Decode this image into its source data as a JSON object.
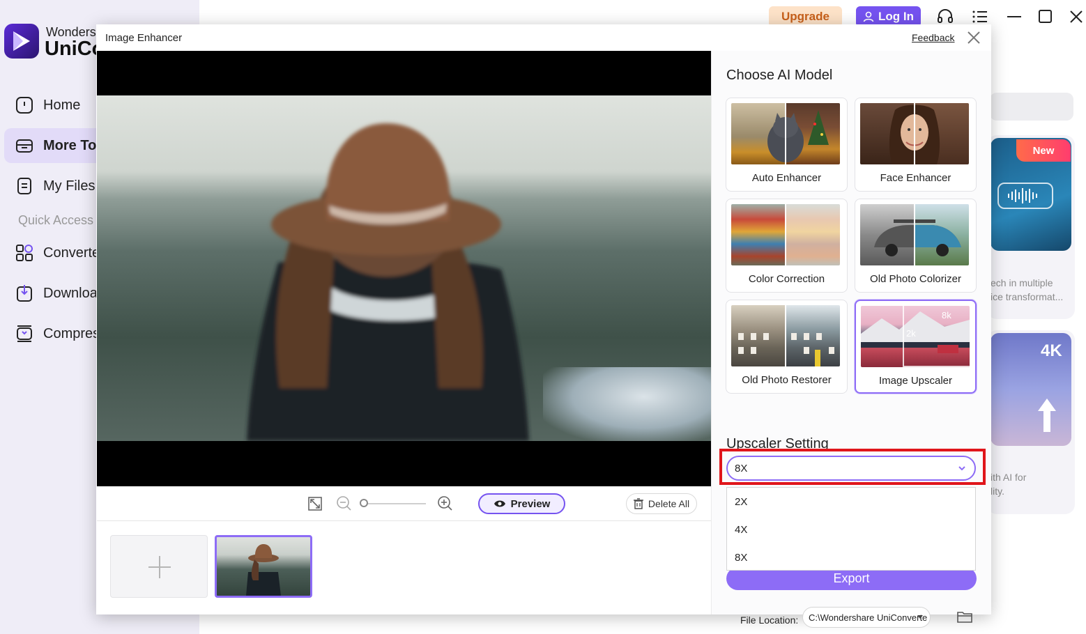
{
  "app": {
    "brand_line1": "Wonders",
    "brand_line2": "UniCo",
    "upgrade_label": "Upgrade",
    "login_label": "Log In"
  },
  "sidebar": {
    "items": [
      {
        "label": "Home",
        "icon": "home-icon"
      },
      {
        "label": "More To",
        "icon": "toolbox-icon",
        "active": true
      },
      {
        "label": "My Files",
        "icon": "files-icon"
      }
    ],
    "quick_access_label": "Quick Access",
    "quick_items": [
      {
        "label": "Converte",
        "icon": "converter-icon"
      },
      {
        "label": "Downloa",
        "icon": "download-icon"
      },
      {
        "label": "Compres",
        "icon": "compress-icon"
      }
    ]
  },
  "background_cards": {
    "new_badge": "New",
    "card1_line1": "ech in multiple",
    "card1_line2": "ice transformat...",
    "card2_badge": "4K",
    "card2_line1": "ith AI for",
    "card2_line2": "lity."
  },
  "modal": {
    "title": "Image Enhancer",
    "feedback": "Feedback",
    "preview_label": "Preview",
    "delete_all_label": "Delete All",
    "choose_model_title": "Choose AI Model",
    "models": [
      {
        "label": "Auto Enhancer"
      },
      {
        "label": "Face Enhancer"
      },
      {
        "label": "Color Correction"
      },
      {
        "label": "Old Photo Colorizer"
      },
      {
        "label": "Old Photo Restorer"
      },
      {
        "label": "Image Upscaler",
        "selected": true,
        "badges": [
          "2k",
          "8k"
        ]
      }
    ],
    "upscaler_setting_title": "Upscaler Setting",
    "upscale_value": "8X",
    "upscale_options": [
      "2X",
      "4X",
      "8X"
    ],
    "export_label": "Export",
    "file_location_label": "File Location:",
    "file_location_value": "C:\\Wondershare UniConverte"
  },
  "colors": {
    "accent": "#8d6cf6",
    "highlight": "#e0161b",
    "upgrade": "#c8601a"
  }
}
